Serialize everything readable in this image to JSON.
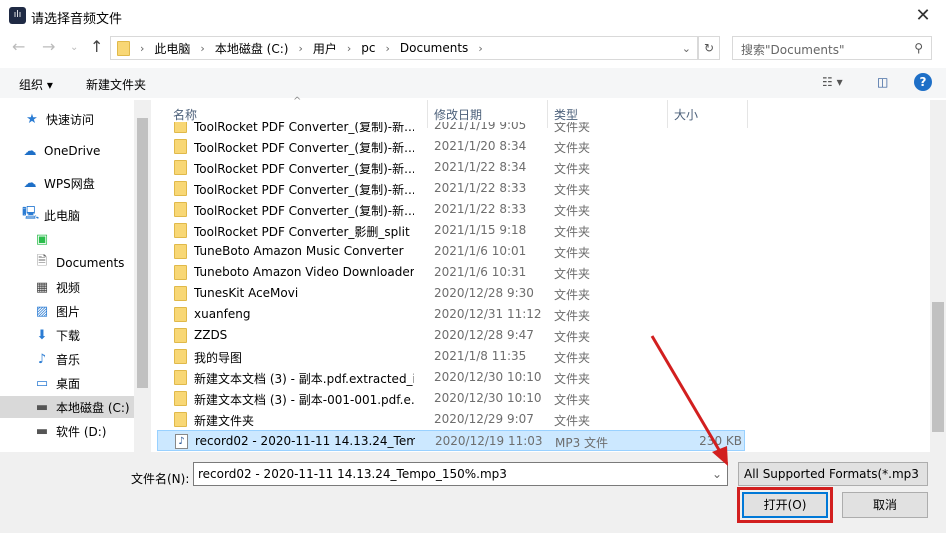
{
  "window": {
    "title": "请选择音频文件",
    "close": "✕"
  },
  "address": {
    "crumbs": [
      "此电脑",
      "本地磁盘 (C:)",
      "用户",
      "pc",
      "Documents"
    ],
    "search_placeholder": "搜索\"Documents\""
  },
  "toolbar": {
    "organize": "组织 ▾",
    "new_folder": "新建文件夹",
    "help": "?"
  },
  "nav": [
    {
      "label": "快速访问",
      "icon": "star-icon"
    },
    {
      "label": "OneDrive",
      "icon": "cloud-icon"
    },
    {
      "label": "WPS网盘",
      "icon": "cloud-icon"
    },
    {
      "label": "此电脑",
      "icon": "computer-icon"
    },
    {
      "label": "",
      "icon": "app-icon"
    },
    {
      "label": "Documents",
      "icon": "document-icon"
    },
    {
      "label": "视频",
      "icon": "video-icon"
    },
    {
      "label": "图片",
      "icon": "picture-icon"
    },
    {
      "label": "下载",
      "icon": "download-icon"
    },
    {
      "label": "音乐",
      "icon": "music-icon"
    },
    {
      "label": "桌面",
      "icon": "desktop-icon"
    },
    {
      "label": "本地磁盘 (C:)",
      "icon": "drive-icon"
    },
    {
      "label": "软件 (D:)",
      "icon": "drive-icon"
    }
  ],
  "columns": {
    "name": "名称",
    "date": "修改日期",
    "type": "类型",
    "size": "大小"
  },
  "files": [
    {
      "name": "ToolRocket PDF Converter_(复制)-新...",
      "date": "2021/1/19 9:05",
      "type": "文件夹",
      "size": ""
    },
    {
      "name": "ToolRocket PDF Converter_(复制)-新...",
      "date": "2021/1/20 8:34",
      "type": "文件夹",
      "size": ""
    },
    {
      "name": "ToolRocket PDF Converter_(复制)-新...",
      "date": "2021/1/22 8:34",
      "type": "文件夹",
      "size": ""
    },
    {
      "name": "ToolRocket PDF Converter_(复制)-新...",
      "date": "2021/1/22 8:33",
      "type": "文件夹",
      "size": ""
    },
    {
      "name": "ToolRocket PDF Converter_(复制)-新...",
      "date": "2021/1/22 8:33",
      "type": "文件夹",
      "size": ""
    },
    {
      "name": "ToolRocket PDF Converter_影删_split",
      "date": "2021/1/15 9:18",
      "type": "文件夹",
      "size": ""
    },
    {
      "name": "TuneBoto Amazon Music Converter",
      "date": "2021/1/6 10:01",
      "type": "文件夹",
      "size": ""
    },
    {
      "name": "Tuneboto Amazon Video Downloader",
      "date": "2021/1/6 10:31",
      "type": "文件夹",
      "size": ""
    },
    {
      "name": "TunesKit AceMovi",
      "date": "2020/12/28 9:30",
      "type": "文件夹",
      "size": ""
    },
    {
      "name": "xuanfeng",
      "date": "2020/12/31 11:12",
      "type": "文件夹",
      "size": ""
    },
    {
      "name": "ZZDS",
      "date": "2020/12/28 9:47",
      "type": "文件夹",
      "size": ""
    },
    {
      "name": "我的导图",
      "date": "2021/1/8 11:35",
      "type": "文件夹",
      "size": ""
    },
    {
      "name": "新建文本文档 (3) - 副本.pdf.extracted_i...",
      "date": "2020/12/30 10:10",
      "type": "文件夹",
      "size": ""
    },
    {
      "name": "新建文本文档 (3) - 副本-001-001.pdf.e...",
      "date": "2020/12/30 10:10",
      "type": "文件夹",
      "size": ""
    },
    {
      "name": "新建文件夹",
      "date": "2020/12/29 9:07",
      "type": "文件夹",
      "size": ""
    },
    {
      "name": "record02 - 2020-11-11 14.13.24_Tem...",
      "date": "2020/12/19 11:03",
      "type": "MP3 文件",
      "size": "230 KB",
      "selected": true
    }
  ],
  "bottom": {
    "filename_label": "文件名(N):",
    "filename_value": "record02 - 2020-11-11 14.13.24_Tempo_150%.mp3",
    "filter": "All Supported Formats(*.mp3",
    "open": "打开(O)",
    "cancel": "取消"
  },
  "colors": {
    "selection": "#cce8ff",
    "accent": "#0078d7",
    "highlight": "#d21f1f"
  }
}
